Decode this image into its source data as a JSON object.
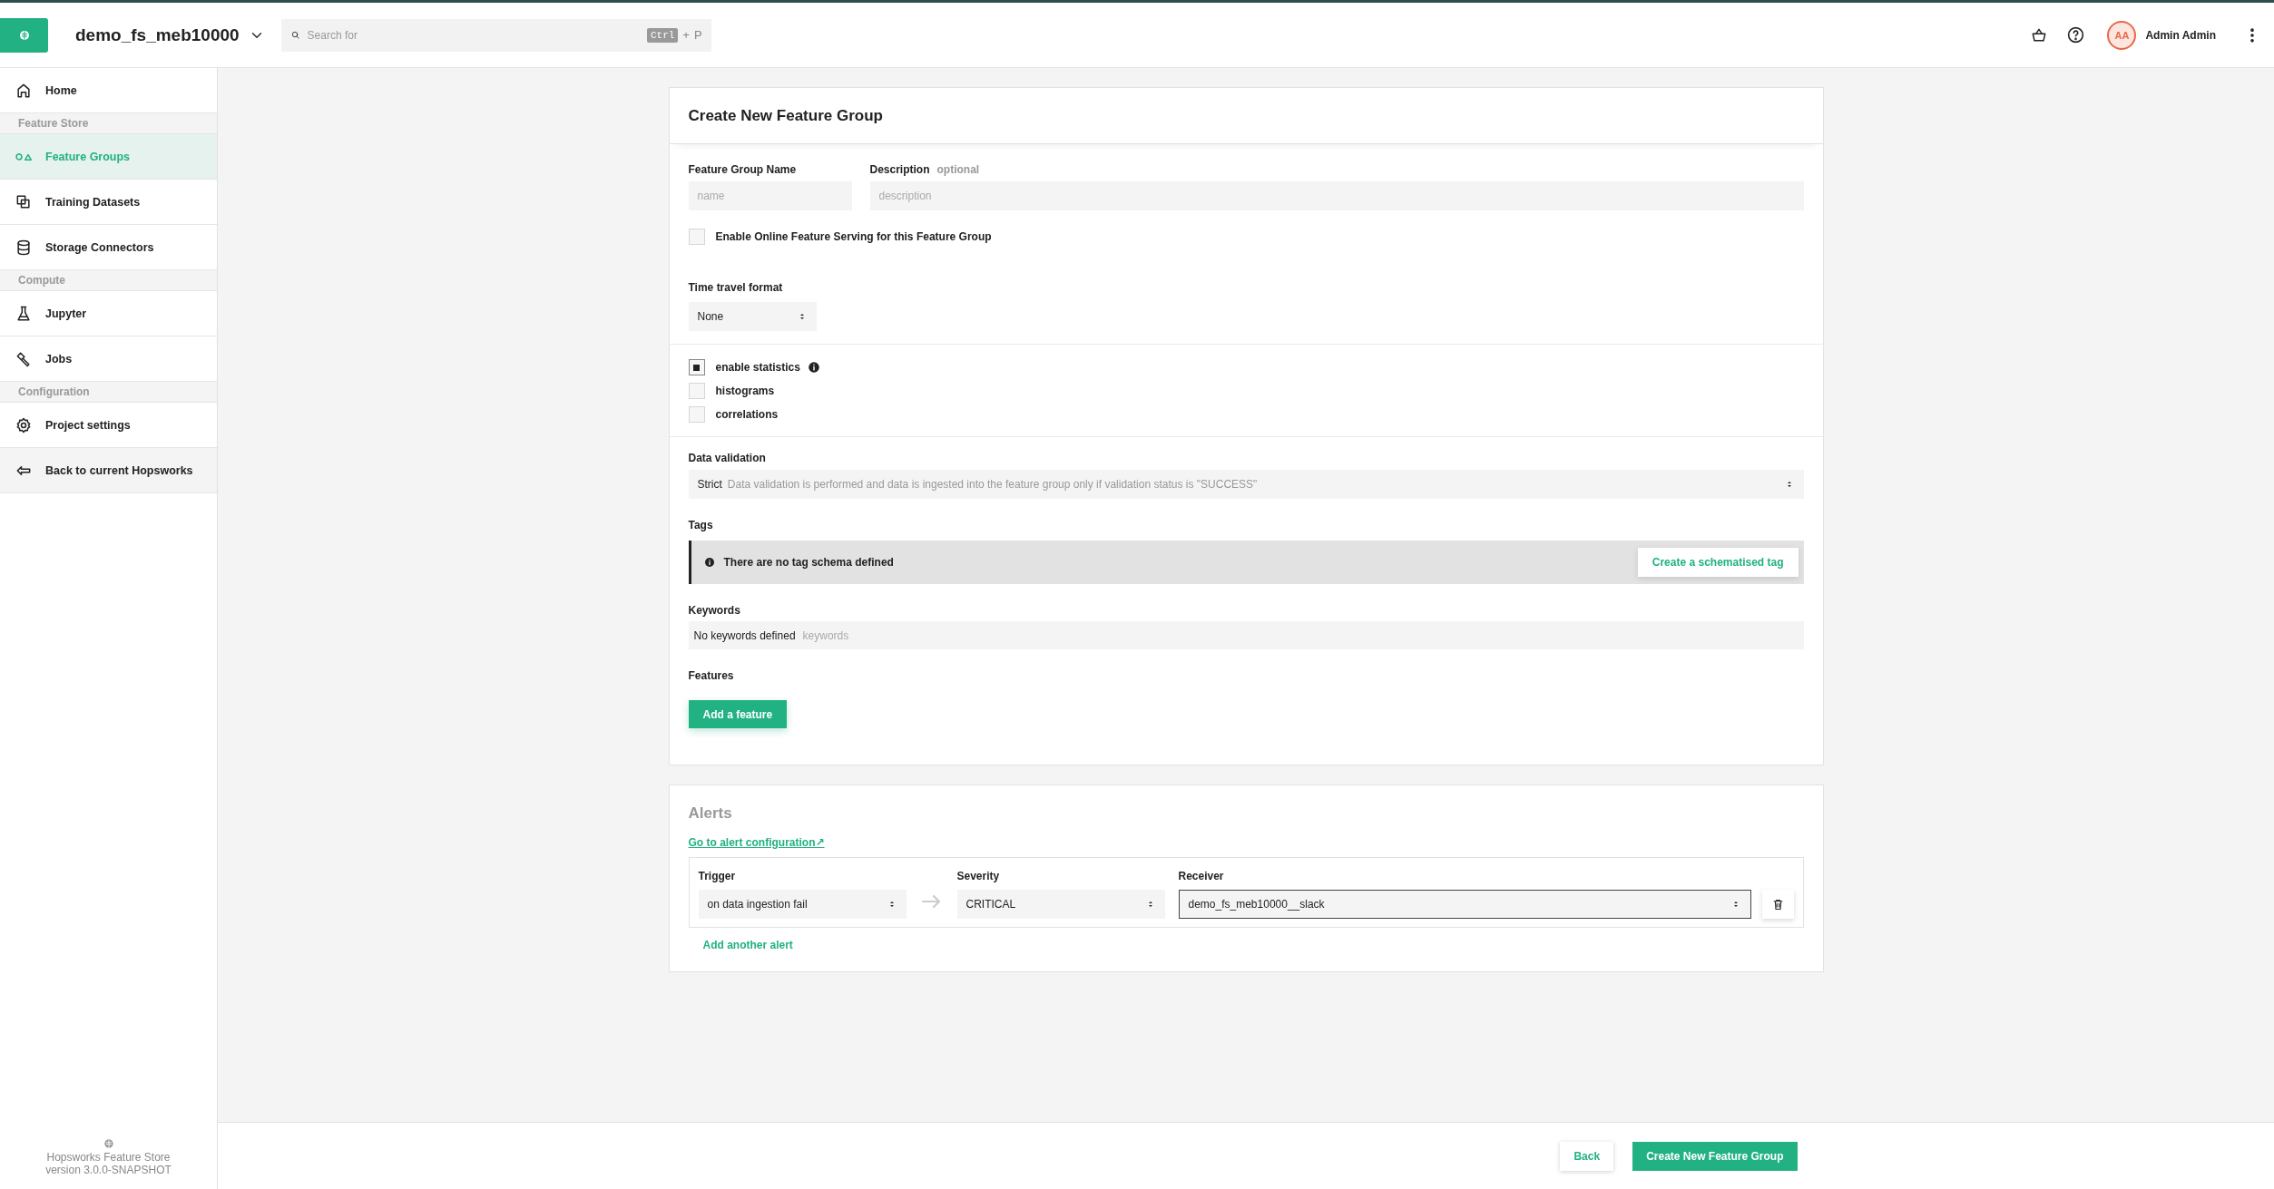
{
  "topbar": {
    "project": "demo_fs_meb10000",
    "search": {
      "placeholder": "Search for",
      "key": "Ctrl",
      "plus": "+",
      "letter": "P"
    },
    "user": {
      "initials": "AA",
      "name": "Admin Admin"
    }
  },
  "sidebar": {
    "items": [
      {
        "kind": "item",
        "label": "Home",
        "selected": false
      },
      {
        "kind": "section",
        "label": "Feature Store"
      },
      {
        "kind": "item",
        "label": "Feature Groups",
        "selected": true
      },
      {
        "kind": "item",
        "label": "Training Datasets",
        "selected": false
      },
      {
        "kind": "item",
        "label": "Storage Connectors",
        "selected": false
      },
      {
        "kind": "section",
        "label": "Compute"
      },
      {
        "kind": "item",
        "label": "Jupyter",
        "selected": false
      },
      {
        "kind": "item",
        "label": "Jobs",
        "selected": false
      },
      {
        "kind": "section",
        "label": "Configuration"
      },
      {
        "kind": "item",
        "label": "Project settings",
        "selected": false
      },
      {
        "kind": "back",
        "label": "Back to current Hopsworks",
        "selected": false
      }
    ],
    "footer": [
      "Hopsworks Feature Store",
      "version 3.0.0-SNAPSHOT"
    ]
  },
  "form": {
    "title": "Create New Feature Group",
    "name_field": {
      "label": "Feature Group Name",
      "placeholder": "name"
    },
    "description_field": {
      "label": "Description",
      "hint": "optional",
      "placeholder": "description"
    },
    "online_serving": {
      "label": "Enable Online Feature Serving for this Feature Group",
      "checked": false
    },
    "time_travel": {
      "label": "Time travel format",
      "value": "None"
    },
    "statistics": [
      {
        "label": "enable statistics",
        "checked": true,
        "info": true
      },
      {
        "label": "histograms",
        "checked": false,
        "info": false
      },
      {
        "label": "correlations",
        "checked": false,
        "info": false
      }
    ],
    "data_validation": {
      "label": "Data validation",
      "value": "Strict",
      "description": "Data validation is performed and data is ingested into the feature group only if validation status is \"SUCCESS\""
    },
    "tags": {
      "label": "Tags",
      "message": "There are no tag schema defined",
      "button": "Create a schematised tag"
    },
    "keywords": {
      "label": "Keywords",
      "value": "No keywords defined",
      "placeholder": "keywords"
    },
    "features": {
      "label": "Features",
      "button": "Add a feature"
    }
  },
  "alerts": {
    "title": "Alerts",
    "link": "Go to alert configuration↗",
    "columns": [
      "Trigger",
      "Severity",
      "Receiver"
    ],
    "rows": [
      {
        "trigger": "on data ingestion fail",
        "severity": "CRITICAL",
        "receiver": "demo_fs_meb10000__slack"
      }
    ],
    "add_button": "Add another alert"
  },
  "footer_buttons": [
    {
      "label": "Back",
      "kind": "secondary"
    },
    {
      "label": "Create New Feature Group",
      "kind": "primary"
    }
  ]
}
